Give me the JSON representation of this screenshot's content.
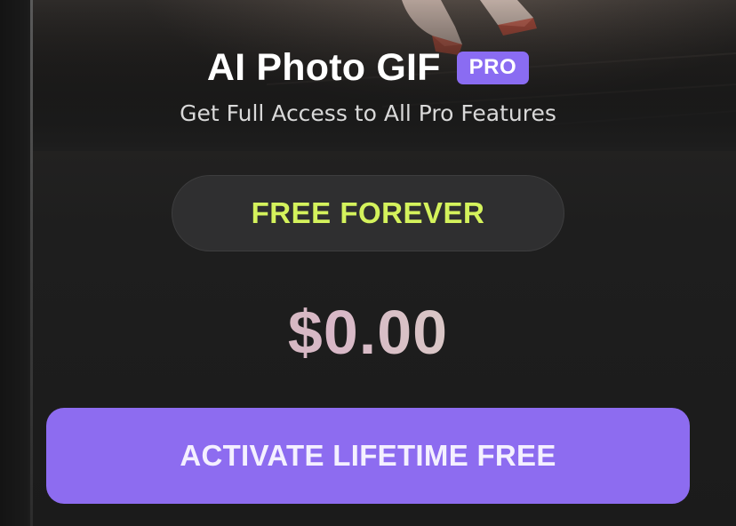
{
  "header": {
    "app_title": "AI Photo GIF",
    "badge": "PRO",
    "subtitle": "Get Full Access to All Pro Features"
  },
  "plan": {
    "label": "FREE FOREVER"
  },
  "price": {
    "amount": "$0.00"
  },
  "cta": {
    "label": "ACTIVATE LIFETIME FREE"
  },
  "colors": {
    "accent": "#8d6cf0",
    "plan_label": "#d4f25c",
    "background": "#1c1c1c"
  }
}
